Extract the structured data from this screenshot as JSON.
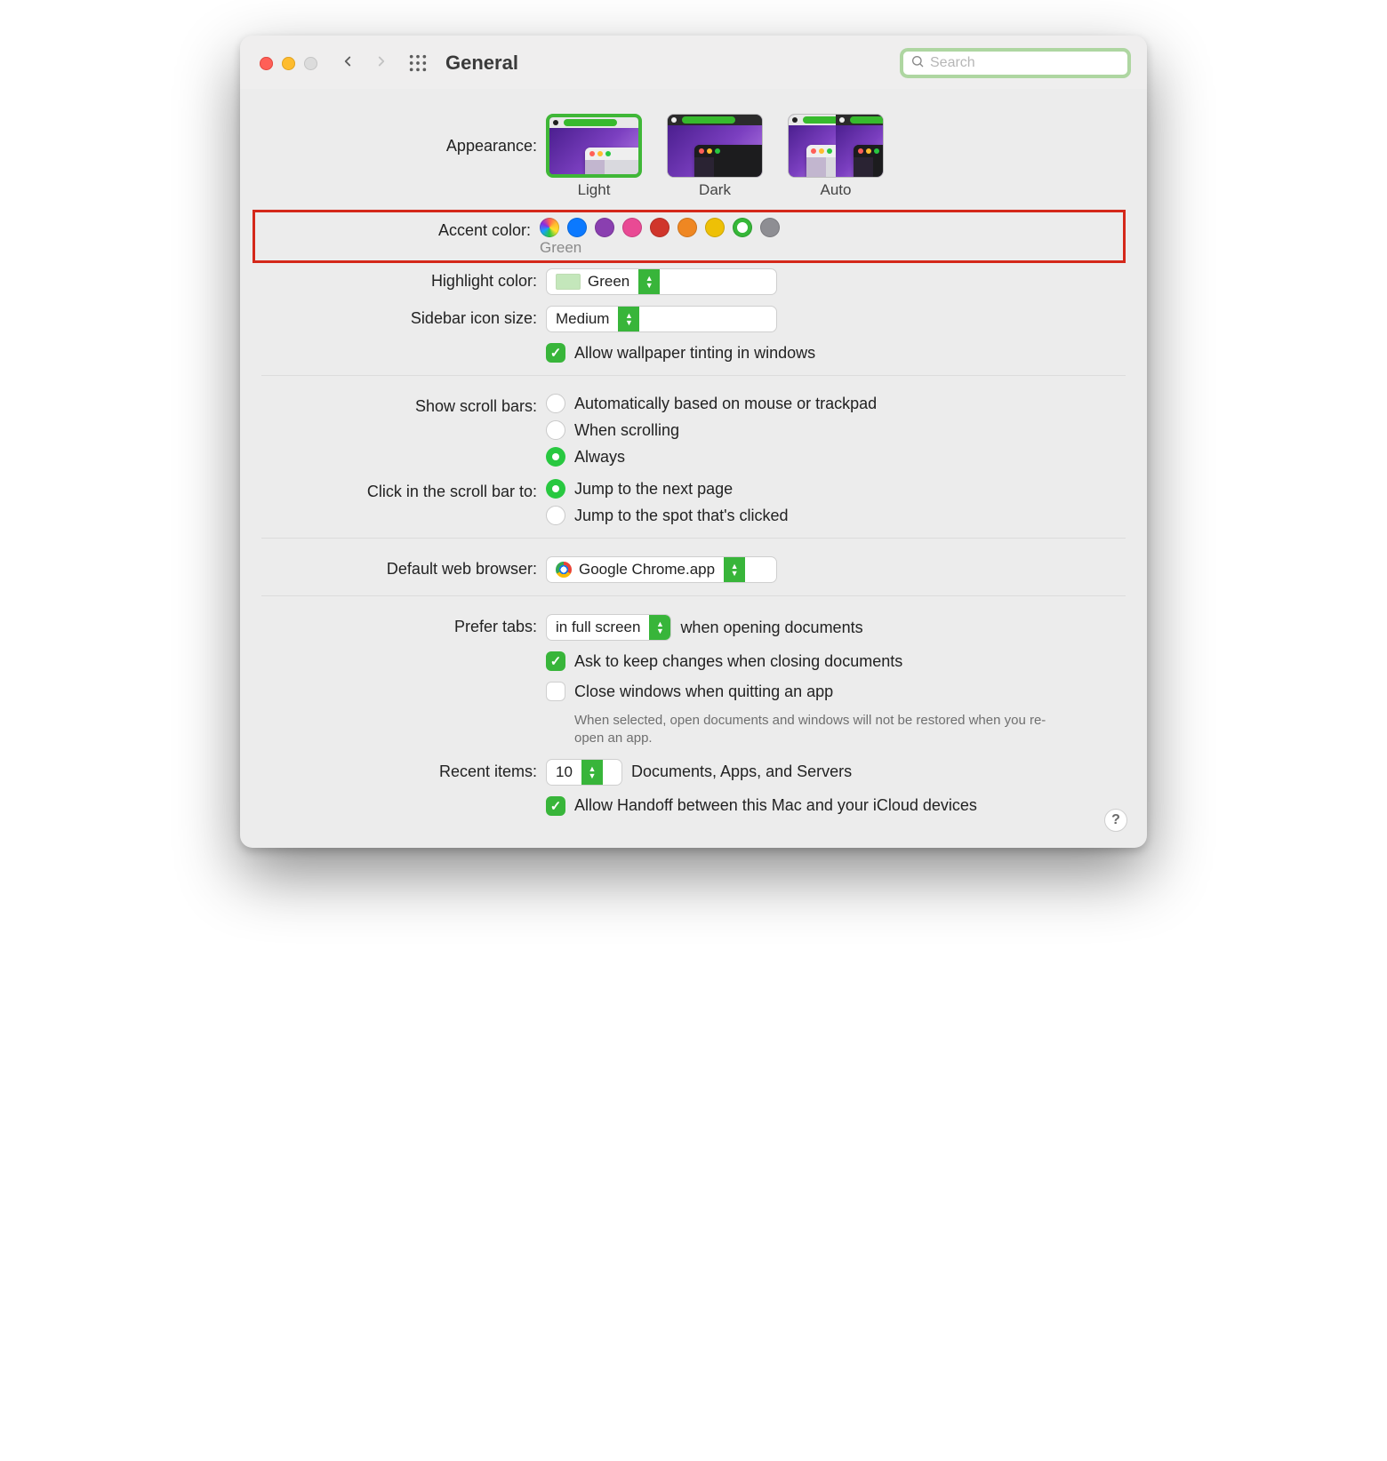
{
  "toolbar": {
    "title": "General",
    "search_placeholder": "Search"
  },
  "labels": {
    "appearance": "Appearance:",
    "accent": "Accent color:",
    "highlight": "Highlight color:",
    "sidebar": "Sidebar icon size:",
    "scrollbars": "Show scroll bars:",
    "click_scroll": "Click in the scroll bar to:",
    "browser": "Default web browser:",
    "prefer_tabs": "Prefer tabs:",
    "recent": "Recent items:"
  },
  "appearance": {
    "options": [
      "Light",
      "Dark",
      "Auto"
    ],
    "selected": "Light"
  },
  "accent": {
    "colors": {
      "blue": "#0b79ff",
      "purple": "#8a3fb0",
      "pink": "#e94a94",
      "red": "#d0352b",
      "orange": "#ef8722",
      "yellow": "#eec006",
      "green": "#36b738",
      "graphite": "#8e8e93"
    },
    "selected_label": "Green"
  },
  "highlight": {
    "value": "Green"
  },
  "sidebar": {
    "value": "Medium"
  },
  "wallpaper_tint": {
    "label": "Allow wallpaper tinting in windows",
    "checked": true
  },
  "scrollbars": {
    "options": [
      "Automatically based on mouse or trackpad",
      "When scrolling",
      "Always"
    ],
    "selected_index": 2
  },
  "click_scroll": {
    "options": [
      "Jump to the next page",
      "Jump to the spot that's clicked"
    ],
    "selected_index": 0
  },
  "browser": {
    "value": "Google Chrome.app"
  },
  "tabs": {
    "value": "in full screen",
    "suffix": "when opening documents",
    "ask_label": "Ask to keep changes when closing documents",
    "ask_checked": true,
    "close_label": "Close windows when quitting an app",
    "close_checked": false,
    "close_hint": "When selected, open documents and windows will not be restored when you re-open an app."
  },
  "recent": {
    "value": "10",
    "suffix": "Documents, Apps, and Servers"
  },
  "handoff": {
    "label": "Allow Handoff between this Mac and your iCloud devices",
    "checked": true
  },
  "help": "?"
}
